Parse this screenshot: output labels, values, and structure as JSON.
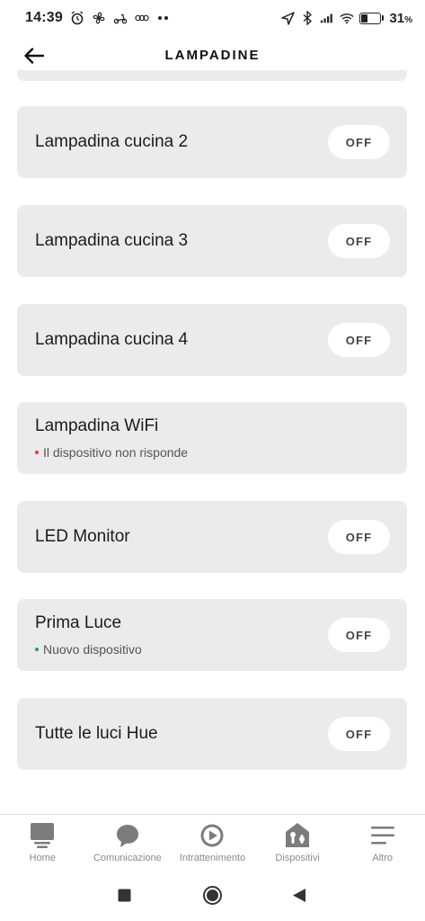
{
  "status_bar": {
    "time": "14:39",
    "battery_level": 0.31,
    "battery_text": "31",
    "battery_unit": "%",
    "icons": [
      "alarm-icon",
      "fan-icon",
      "scooter-icon",
      "glasses-icon",
      "more-dots-icon",
      "location-arrow-icon",
      "bluetooth-icon",
      "signal-icon",
      "wifi-icon",
      "battery-icon"
    ]
  },
  "header": {
    "title": "LAMPADINE",
    "back_icon": "arrow-left-icon"
  },
  "colors": {
    "card_bg": "#ebebeb",
    "warning_dot": "#e53935",
    "ok_dot": "#2e9d4f",
    "nav_text": "#8a8a8a"
  },
  "devices": [
    {
      "name": "Lampadina cucina 2",
      "toggle": "OFF"
    },
    {
      "name": "Lampadina cucina 3",
      "toggle": "OFF"
    },
    {
      "name": "Lampadina cucina 4",
      "toggle": "OFF"
    },
    {
      "name": "Lampadina WiFi",
      "status": "Il dispositivo non risponde",
      "status_color": "#e53935"
    },
    {
      "name": "LED Monitor",
      "toggle": "OFF"
    },
    {
      "name": "Prima Luce",
      "status": "Nuovo dispositivo",
      "status_color": "#2e9d4f",
      "toggle": "OFF"
    },
    {
      "name": "Tutte le luci Hue",
      "toggle": "OFF"
    }
  ],
  "bottom_nav": [
    {
      "label": "Home",
      "icon": "home-icon"
    },
    {
      "label": "Comunicazione",
      "icon": "chat-bubble-icon"
    },
    {
      "label": "Intrattenimento",
      "icon": "play-icon"
    },
    {
      "label": "Dispositivi",
      "icon": "devices-house-icon"
    },
    {
      "label": "Altro",
      "icon": "menu-lines-icon"
    }
  ],
  "system_nav": [
    "recents-square-icon",
    "home-circle-icon",
    "back-triangle-icon"
  ]
}
